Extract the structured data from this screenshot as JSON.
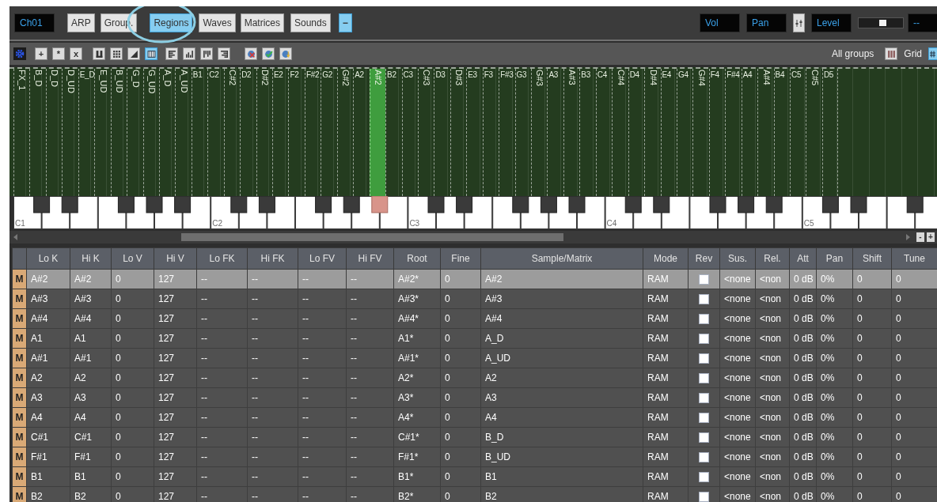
{
  "toolbar": {
    "channel": "Ch01",
    "tabs": [
      {
        "label": "ARP",
        "selected": false
      },
      {
        "label": "Group.",
        "selected": false
      },
      {
        "label": "Regions",
        "selected": true
      },
      {
        "label": "Waves",
        "selected": false
      },
      {
        "label": "Matrices",
        "selected": false
      },
      {
        "label": "Sounds",
        "selected": false
      }
    ],
    "collapse_button": "−",
    "vol_field": "Vol",
    "pan_field": "Pan",
    "level_field": "Level",
    "level_slider": {
      "level": 0.55
    },
    "value_field": "--"
  },
  "tools": {
    "edit_buttons": [
      "+",
      "*",
      "x"
    ],
    "view_buttons": [
      {
        "kind": "columns",
        "selected": false
      },
      {
        "kind": "dots",
        "selected": false
      },
      {
        "kind": "ramp",
        "selected": false
      },
      {
        "kind": "keyboard",
        "selected": true
      },
      {
        "kind": "bars-left",
        "selected": false
      },
      {
        "kind": "bars-up",
        "selected": false
      },
      {
        "kind": "bars-down",
        "selected": false
      },
      {
        "kind": "bars-right",
        "selected": false
      },
      {
        "kind": "cancel",
        "selected": false
      },
      {
        "kind": "check",
        "selected": false
      },
      {
        "kind": "import",
        "selected": false
      }
    ],
    "filter_label": "All groups",
    "grid_label": "Grid"
  },
  "zones": [
    {
      "label": "FX_1",
      "vertical": true,
      "selected": false
    },
    {
      "label": "B_D",
      "vertical": true,
      "selected": false
    },
    {
      "label": "D_D",
      "vertical": true,
      "selected": false
    },
    {
      "label": "D_UD",
      "vertical": true,
      "selected": false
    },
    {
      "label": "E_D",
      "vertical": false,
      "selected": false
    },
    {
      "label": "E_UD",
      "vertical": true,
      "selected": false
    },
    {
      "label": "B_UD",
      "vertical": true,
      "selected": false
    },
    {
      "label": "G_D",
      "vertical": true,
      "selected": false
    },
    {
      "label": "G_UD",
      "vertical": true,
      "selected": false
    },
    {
      "label": "A_D",
      "vertical": true,
      "selected": false
    },
    {
      "label": "A_UD",
      "vertical": true,
      "selected": false
    },
    {
      "label": "B1",
      "vertical": false,
      "selected": false
    },
    {
      "label": "C2",
      "vertical": false,
      "selected": false
    },
    {
      "label": "C#2",
      "vertical": true,
      "selected": false
    },
    {
      "label": "D2",
      "vertical": false,
      "selected": false
    },
    {
      "label": "D#2",
      "vertical": true,
      "selected": false
    },
    {
      "label": "E2",
      "vertical": false,
      "selected": false
    },
    {
      "label": "F2",
      "vertical": false,
      "selected": false
    },
    {
      "label": "F#2",
      "vertical": false,
      "selected": false
    },
    {
      "label": "G2",
      "vertical": false,
      "selected": false
    },
    {
      "label": "G#2",
      "vertical": true,
      "selected": false
    },
    {
      "label": "A2",
      "vertical": false,
      "selected": false
    },
    {
      "label": "A#2",
      "vertical": true,
      "selected": true
    },
    {
      "label": "B2",
      "vertical": false,
      "selected": false
    },
    {
      "label": "C3",
      "vertical": false,
      "selected": false
    },
    {
      "label": "C#3",
      "vertical": true,
      "selected": false
    },
    {
      "label": "D3",
      "vertical": false,
      "selected": false
    },
    {
      "label": "D#3",
      "vertical": true,
      "selected": false
    },
    {
      "label": "E3",
      "vertical": false,
      "selected": false
    },
    {
      "label": "F3",
      "vertical": false,
      "selected": false
    },
    {
      "label": "F#3",
      "vertical": false,
      "selected": false
    },
    {
      "label": "G3",
      "vertical": false,
      "selected": false
    },
    {
      "label": "G#3",
      "vertical": true,
      "selected": false
    },
    {
      "label": "A3",
      "vertical": false,
      "selected": false
    },
    {
      "label": "A#3",
      "vertical": true,
      "selected": false
    },
    {
      "label": "B3",
      "vertical": false,
      "selected": false
    },
    {
      "label": "C4",
      "vertical": false,
      "selected": false
    },
    {
      "label": "C#4",
      "vertical": true,
      "selected": false
    },
    {
      "label": "D4",
      "vertical": false,
      "selected": false
    },
    {
      "label": "D#4",
      "vertical": true,
      "selected": false
    },
    {
      "label": "E4",
      "vertical": false,
      "selected": false
    },
    {
      "label": "G4",
      "vertical": false,
      "selected": false
    },
    {
      "label": "G#4",
      "vertical": true,
      "selected": false
    },
    {
      "label": "F4",
      "vertical": false,
      "selected": false
    },
    {
      "label": "F#4",
      "vertical": false,
      "selected": false
    },
    {
      "label": "A4",
      "vertical": false,
      "selected": false
    },
    {
      "label": "A#4",
      "vertical": true,
      "selected": false
    },
    {
      "label": "B4",
      "vertical": false,
      "selected": false
    },
    {
      "label": "C5",
      "vertical": false,
      "selected": false
    },
    {
      "label": "C#5",
      "vertical": true,
      "selected": false
    },
    {
      "label": "D5",
      "vertical": false,
      "selected": false
    }
  ],
  "keyboard": {
    "octaves": [
      {
        "label": "C1",
        "sharps_lit": [
          false,
          false,
          false,
          false,
          false
        ]
      },
      {
        "label": "C2",
        "sharps_lit": [
          false,
          false,
          false,
          false,
          true
        ]
      },
      {
        "label": "C3",
        "sharps_lit": [
          false,
          false,
          false,
          false,
          false
        ]
      },
      {
        "label": "C4",
        "sharps_lit": [
          false,
          false,
          false,
          false,
          false
        ]
      },
      {
        "label": "C5",
        "sharps_lit": [
          false,
          false,
          false
        ]
      }
    ]
  },
  "scrollbar": {
    "zoom_buttons": [
      "-",
      "+"
    ]
  },
  "table": {
    "columns": [
      {
        "label": "Lo K",
        "kind": "text"
      },
      {
        "label": "Hi K",
        "kind": "text"
      },
      {
        "label": "Lo V",
        "kind": "text"
      },
      {
        "label": "Hi V",
        "kind": "text"
      },
      {
        "label": "Lo FK",
        "kind": "text"
      },
      {
        "label": "Hi FK",
        "kind": "text"
      },
      {
        "label": "Lo FV",
        "kind": "text"
      },
      {
        "label": "Hi FV",
        "kind": "text"
      },
      {
        "label": "Root",
        "kind": "text"
      },
      {
        "label": "Fine",
        "kind": "text"
      },
      {
        "label": "Sample/Matrix",
        "kind": "text"
      },
      {
        "label": "Mode",
        "kind": "text"
      },
      {
        "label": "Rev",
        "kind": "checkbox"
      },
      {
        "label": "Sus.",
        "kind": "text"
      },
      {
        "label": "Rel.",
        "kind": "text"
      },
      {
        "label": "Att",
        "kind": "text"
      },
      {
        "label": "Pan",
        "kind": "text"
      },
      {
        "label": "Shift",
        "kind": "text"
      },
      {
        "label": "Tune",
        "kind": "text"
      }
    ],
    "rows": [
      {
        "mute": "M",
        "selected": true,
        "values": [
          "A#2",
          "A#2",
          "0",
          "127",
          "--",
          "--",
          "--",
          "--",
          "A#2*",
          "0",
          "A#2",
          "RAM",
          false,
          "<none",
          "<non",
          "0 dB",
          "0%",
          "0",
          "0"
        ]
      },
      {
        "mute": "M",
        "selected": false,
        "values": [
          "A#3",
          "A#3",
          "0",
          "127",
          "--",
          "--",
          "--",
          "--",
          "A#3*",
          "0",
          "A#3",
          "RAM",
          false,
          "<none",
          "<non",
          "0 dB",
          "0%",
          "0",
          "0"
        ]
      },
      {
        "mute": "M",
        "selected": false,
        "values": [
          "A#4",
          "A#4",
          "0",
          "127",
          "--",
          "--",
          "--",
          "--",
          "A#4*",
          "0",
          "A#4",
          "RAM",
          false,
          "<none",
          "<non",
          "0 dB",
          "0%",
          "0",
          "0"
        ]
      },
      {
        "mute": "M",
        "selected": false,
        "values": [
          "A1",
          "A1",
          "0",
          "127",
          "--",
          "--",
          "--",
          "--",
          "A1*",
          "0",
          "A_D",
          "RAM",
          false,
          "<none",
          "<non",
          "0 dB",
          "0%",
          "0",
          "0"
        ]
      },
      {
        "mute": "M",
        "selected": false,
        "values": [
          "A#1",
          "A#1",
          "0",
          "127",
          "--",
          "--",
          "--",
          "--",
          "A#1*",
          "0",
          "A_UD",
          "RAM",
          false,
          "<none",
          "<non",
          "0 dB",
          "0%",
          "0",
          "0"
        ]
      },
      {
        "mute": "M",
        "selected": false,
        "values": [
          "A2",
          "A2",
          "0",
          "127",
          "--",
          "--",
          "--",
          "--",
          "A2*",
          "0",
          "A2",
          "RAM",
          false,
          "<none",
          "<non",
          "0 dB",
          "0%",
          "0",
          "0"
        ]
      },
      {
        "mute": "M",
        "selected": false,
        "values": [
          "A3",
          "A3",
          "0",
          "127",
          "--",
          "--",
          "--",
          "--",
          "A3*",
          "0",
          "A3",
          "RAM",
          false,
          "<none",
          "<non",
          "0 dB",
          "0%",
          "0",
          "0"
        ]
      },
      {
        "mute": "M",
        "selected": false,
        "values": [
          "A4",
          "A4",
          "0",
          "127",
          "--",
          "--",
          "--",
          "--",
          "A4*",
          "0",
          "A4",
          "RAM",
          false,
          "<none",
          "<non",
          "0 dB",
          "0%",
          "0",
          "0"
        ]
      },
      {
        "mute": "M",
        "selected": false,
        "values": [
          "C#1",
          "C#1",
          "0",
          "127",
          "--",
          "--",
          "--",
          "--",
          "C#1*",
          "0",
          "B_D",
          "RAM",
          false,
          "<none",
          "<non",
          "0 dB",
          "0%",
          "0",
          "0"
        ]
      },
      {
        "mute": "M",
        "selected": false,
        "values": [
          "F#1",
          "F#1",
          "0",
          "127",
          "--",
          "--",
          "--",
          "--",
          "F#1*",
          "0",
          "B_UD",
          "RAM",
          false,
          "<none",
          "<non",
          "0 dB",
          "0%",
          "0",
          "0"
        ]
      },
      {
        "mute": "M",
        "selected": false,
        "values": [
          "B1",
          "B1",
          "0",
          "127",
          "--",
          "--",
          "--",
          "--",
          "B1*",
          "0",
          "B1",
          "RAM",
          false,
          "<none",
          "<non",
          "0 dB",
          "0%",
          "0",
          "0"
        ]
      },
      {
        "mute": "M",
        "selected": false,
        "values": [
          "B2",
          "B2",
          "0",
          "127",
          "--",
          "--",
          "--",
          "--",
          "B2*",
          "0",
          "B2",
          "RAM",
          false,
          "<none",
          "<non",
          "0 dB",
          "0%",
          "0",
          "0"
        ]
      }
    ]
  }
}
